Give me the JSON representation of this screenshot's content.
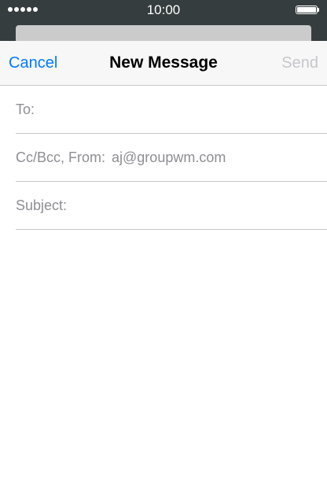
{
  "status_bar": {
    "signal_icon": "signal-dots-icon",
    "signal_dots": 5,
    "time": "10:00",
    "battery_icon": "battery-icon",
    "battery_level": 1.0
  },
  "nav": {
    "cancel_label": "Cancel",
    "title": "New Message",
    "send_label": "Send"
  },
  "fields": {
    "to_label": "To:",
    "cc_bcc_from_label": "Cc/Bcc, From:",
    "from_value": "aj@groupwm.com",
    "subject_label": "Subject:"
  },
  "colors": {
    "status_bar_bg": "#363d3e",
    "accent": "#007aff",
    "disabled": "#c7c7cc",
    "label_gray": "#8e8e93",
    "separator": "#c8c7cc"
  }
}
